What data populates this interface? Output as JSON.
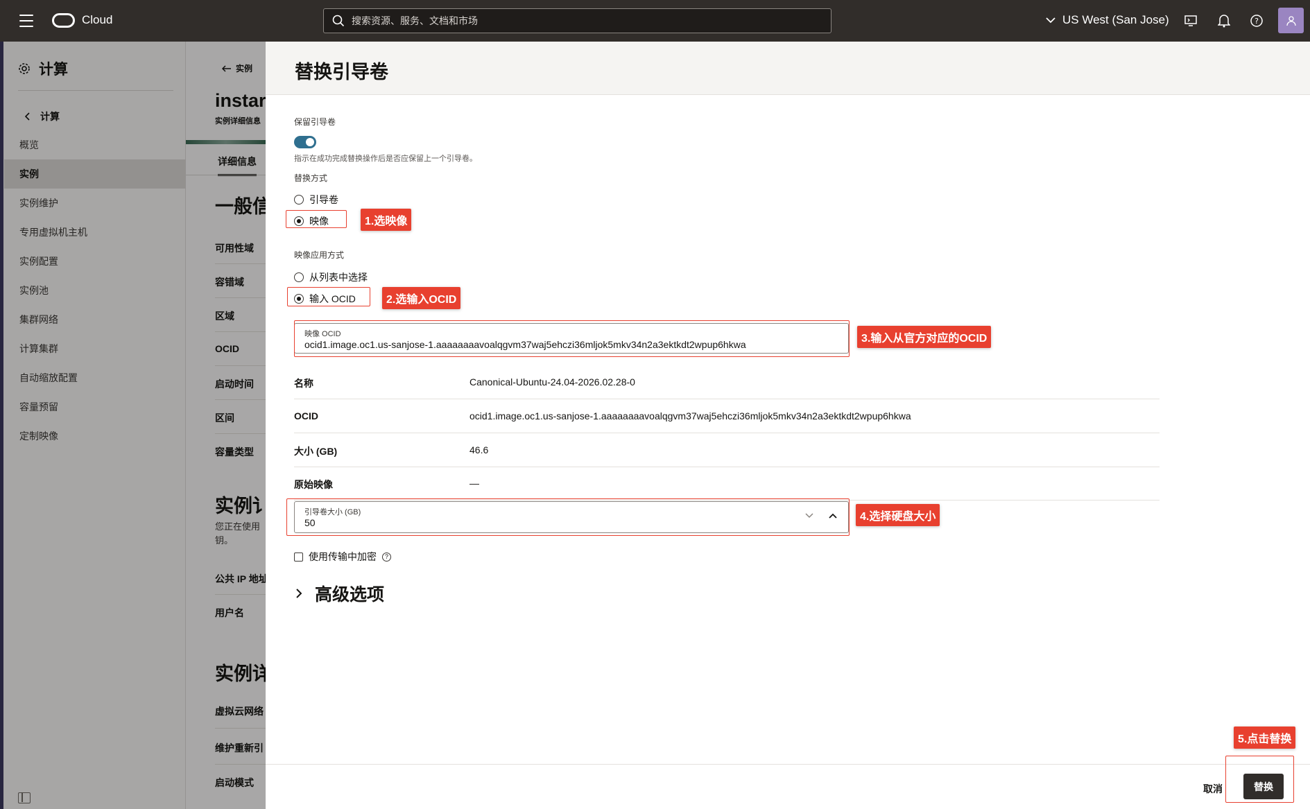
{
  "topbar": {
    "brand": "Cloud",
    "search_placeholder": "搜索资源、服务、文档和市场",
    "region": "US West (San Jose)"
  },
  "leftnav": {
    "title": "计算",
    "back_label": "计算",
    "items": [
      "概览",
      "实例",
      "实例维护",
      "专用虚拟机主机",
      "实例配置",
      "实例池",
      "集群网络",
      "计算集群",
      "自动缩放配置",
      "容量预留",
      "定制映像"
    ],
    "active_item": "实例"
  },
  "bg_page": {
    "back_label": "实例",
    "title": "instar",
    "subtitle": "实例详细信息",
    "tab": "详细信息",
    "section1": "一般信",
    "rows1": [
      "可用性域",
      "容错域",
      "区域",
      "OCID",
      "启动时间",
      "区间",
      "容量类型"
    ],
    "section2": "实例讠",
    "section2_text": "您正在使用钥。",
    "rows2": [
      "公共 IP 地址",
      "用户名"
    ],
    "section3": "实例详",
    "rows3": [
      "虚拟云网络",
      "维护重新引",
      "启动模式"
    ]
  },
  "drawer": {
    "title": "替换引导卷",
    "preserve_label": "保留引导卷",
    "preserve_on": true,
    "preserve_hint": "指示在成功完成替换操作后是否应保留上一个引导卷。",
    "replace_method_label": "替换方式",
    "replace_options": [
      "引导卷",
      "映像"
    ],
    "replace_selected": "映像",
    "image_method_label": "映像应用方式",
    "image_options": [
      "从列表中选择",
      "输入 OCID"
    ],
    "image_selected": "输入 OCID",
    "ocid_field_label": "映像 OCID",
    "ocid_value": "ocid1.image.oc1.us-sanjose-1.aaaaaaaavoalqgvm37waj5ehczi36mljok5mkv34n2a3ektkdt2wpup6hkwa",
    "info": [
      {
        "k": "名称",
        "v": "Canonical-Ubuntu-24.04-2026.02.28-0"
      },
      {
        "k": "OCID",
        "v": "ocid1.image.oc1.us-sanjose-1.aaaaaaaavoalqgvm37waj5ehczi36mljok5mkv34n2a3ektkdt2wpup6hkwa"
      },
      {
        "k": "大小 (GB)",
        "v": "46.6"
      },
      {
        "k": "原始映像",
        "v": "—"
      }
    ],
    "boot_size_label": "引导卷大小 (GB)",
    "boot_size_value": "50",
    "transit_encryption_label": "使用传输中加密",
    "advanced_label": "高级选项",
    "cancel_label": "取消",
    "replace_label": "替换"
  },
  "annotations": {
    "step1": "1.选映像",
    "step2": "2.选输入OCID",
    "step3": "3.输入从官方对应的OCID",
    "step4": "4.选择硬盘大小",
    "step5": "5.点击替换"
  },
  "colors": {
    "topbar": "#312d2a",
    "annotation_red": "#e8402f",
    "toggle_on": "#2f6f8f",
    "primary_button": "#312d2a"
  }
}
